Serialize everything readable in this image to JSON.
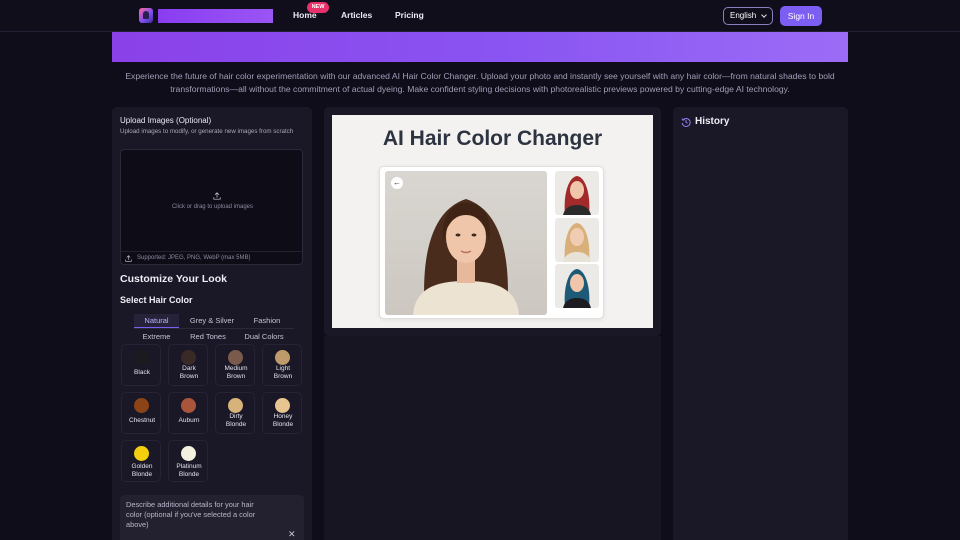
{
  "nav": {
    "links": [
      "Home",
      "Articles",
      "Pricing"
    ],
    "new_badge": "NEW",
    "language": "English",
    "sign_in": "Sign In"
  },
  "intro": "Experience the future of hair color experimentation with our advanced AI Hair Color Changer. Upload your photo and instantly see yourself with any hair color—from natural shades to bold transformations—all without the commitment of actual dyeing. Make confident styling decisions with photorealistic previews powered by cutting-edge AI technology.",
  "upload": {
    "title": "Upload Images (Optional)",
    "subtitle": "Upload images to modify, or generate new images from scratch",
    "dropzone_text": "Click or drag to upload images",
    "supported": "Supported: JPEG, PNG, WebP (max 5MB)"
  },
  "customize": {
    "heading": "Customize Your Look",
    "select_heading": "Select Hair Color",
    "tabs": [
      "Natural",
      "Grey & Silver",
      "Fashion",
      "Extreme",
      "Red Tones",
      "Dual Colors"
    ],
    "active_tab": "Natural",
    "colors": [
      {
        "label": "Black",
        "color": "#1b1a1f"
      },
      {
        "label": "Dark Brown",
        "color": "#3a2a25"
      },
      {
        "label": "Medium Brown",
        "color": "#7a5a4b"
      },
      {
        "label": "Light Brown",
        "color": "#bf9b6c"
      },
      {
        "label": "Chestnut",
        "color": "#8c4316"
      },
      {
        "label": "Auburn",
        "color": "#a8553c"
      },
      {
        "label": "Dirty Blonde",
        "color": "#d7b27a"
      },
      {
        "label": "Honey Blonde",
        "color": "#e6c590"
      },
      {
        "label": "Golden Blonde",
        "color": "#f3cf10"
      },
      {
        "label": "Platinum Blonde",
        "color": "#f4f1df"
      }
    ],
    "description_placeholder": "Describe additional details for your hair color (optional if you've selected a color above)"
  },
  "preview": {
    "title": "AI Hair Color Changer",
    "thumb_colors": [
      "#a32a2a",
      "#d9b07a",
      "#1d5a78"
    ]
  },
  "history": {
    "title": "History"
  },
  "icons": {
    "upload": "upload-icon",
    "history": "history-icon",
    "close": "close-icon",
    "back": "arrow-left-icon"
  }
}
